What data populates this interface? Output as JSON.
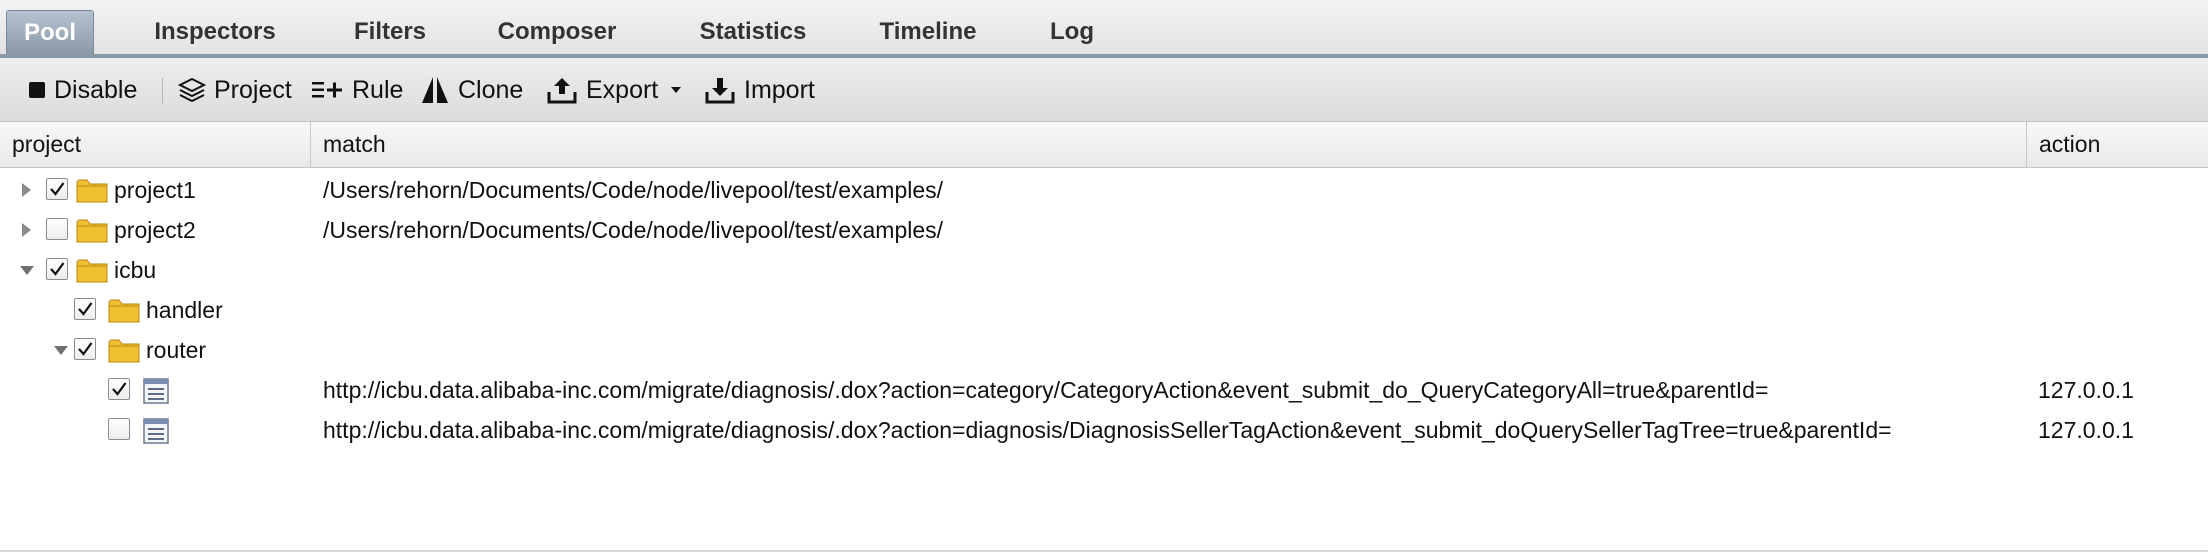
{
  "tabs": [
    {
      "label": "Pool",
      "active": true
    },
    {
      "label": "Inspectors"
    },
    {
      "label": "Filters"
    },
    {
      "label": "Composer"
    },
    {
      "label": "Statistics"
    },
    {
      "label": "Timeline"
    },
    {
      "label": "Log"
    }
  ],
  "toolbar": {
    "disable": "Disable",
    "project": "Project",
    "rule": "Rule",
    "clone": "Clone",
    "export": "Export",
    "import": "Import"
  },
  "columns": {
    "project": "project",
    "match": "match",
    "action": "action"
  },
  "rows": [
    {
      "label": "project1",
      "checked": true,
      "expand": "collapsed",
      "kind": "folder",
      "match": "/Users/rehorn/Documents/Code/node/livepool/test/examples/",
      "action": ""
    },
    {
      "label": "project2",
      "checked": false,
      "expand": "collapsed",
      "kind": "folder",
      "match": "/Users/rehorn/Documents/Code/node/livepool/test/examples/",
      "action": ""
    },
    {
      "label": "icbu",
      "checked": true,
      "expand": "expanded",
      "kind": "folder",
      "match": "",
      "action": ""
    },
    {
      "label": "handler",
      "checked": true,
      "expand": "none",
      "kind": "folder",
      "match": "",
      "action": ""
    },
    {
      "label": "router",
      "checked": true,
      "expand": "expanded",
      "kind": "folder",
      "match": "",
      "action": ""
    },
    {
      "label": "",
      "checked": true,
      "expand": "none",
      "kind": "rule",
      "match": "http://icbu.data.alibaba-inc.com/migrate/diagnosis/.dox?action=category/CategoryAction&event_submit_do_QueryCategoryAll=true&parentId=",
      "action": "127.0.0.1"
    },
    {
      "label": "",
      "checked": false,
      "expand": "none",
      "kind": "rule",
      "match": "http://icbu.data.alibaba-inc.com/migrate/diagnosis/.dox?action=diagnosis/DiagnosisSellerTagAction&event_submit_doQuerySellerTagTree=true&parentId=",
      "action": "127.0.0.1"
    }
  ],
  "colors": {
    "folder": "#f0c030",
    "tab_active": "#8a99a8"
  }
}
